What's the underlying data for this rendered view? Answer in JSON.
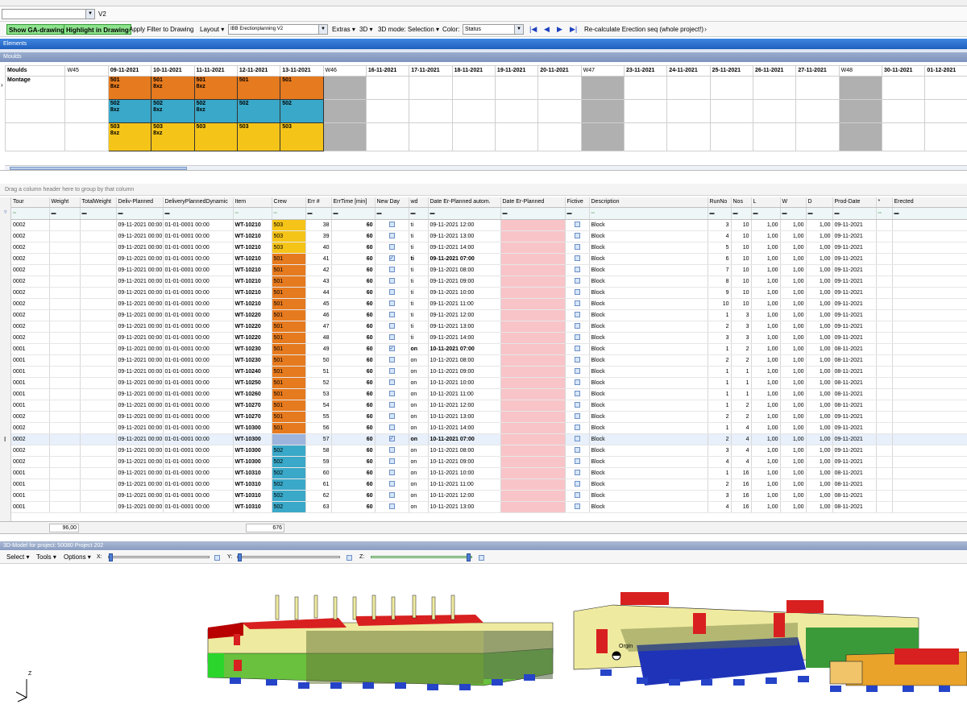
{
  "toolbar1": {
    "version": "V2"
  },
  "toolbar2": {
    "show_ga": "Show GA-drawing",
    "highlight": "Highlight in Drawing",
    "apply_filter": "Apply Filter to Drawing",
    "layout": "Layout",
    "layout_value": "IBB Erectionplanning V2",
    "extras": "Extras",
    "three_d": "3D",
    "mode": "3D mode: Selection",
    "color_label": "Color:",
    "color_value": "Status",
    "recalc": "Re-calculate Erection seq (whole project!)"
  },
  "sections": {
    "elements": "Elements",
    "moulds": "Moulds",
    "model": "3D-Model for project: 50080 Project 202"
  },
  "calendar": {
    "corner": "Moulds",
    "row_label": "Montage",
    "cols": [
      "W45",
      "09-11-2021",
      "10-11-2021",
      "11-11-2021",
      "12-11-2021",
      "13-11-2021",
      "W46",
      "16-11-2021",
      "17-11-2021",
      "18-11-2021",
      "19-11-2021",
      "20-11-2021",
      "W47",
      "23-11-2021",
      "24-11-2021",
      "25-11-2021",
      "26-11-2021",
      "27-11-2021",
      "W48",
      "30-11-2021",
      "01-12-2021"
    ],
    "rows": [
      [
        "501 8xz",
        "501 8xz",
        "501 8xz",
        "501",
        "501"
      ],
      [
        "502 8xz",
        "502 8xz",
        "502 8xz",
        "502",
        "502"
      ],
      [
        "503 8xz",
        "503 8xz",
        "503",
        "503",
        "503"
      ]
    ]
  },
  "group_hint": "Drag a column header here to group by that column",
  "table": {
    "headers": [
      "Tour",
      "Weight",
      "TotalWeight",
      "Deliv-Planned",
      "DeliveryPlannedDynamic",
      "Item",
      "Crew",
      "Err #",
      "ErrTime [min]",
      "New Day",
      "wd",
      "Date Er-Planned autom.",
      "Date Er-Planned",
      "Fictive",
      "Description",
      "RunNo",
      "Nos",
      "L",
      "W",
      "D",
      "Prod-Date",
      "*",
      "Erected"
    ],
    "rows": [
      [
        "0002",
        "09-11-2021 00:00",
        "01-01-0001 00:00",
        "WT-10210",
        "503",
        "38",
        "60",
        "0",
        "ti",
        "09-11-2021 12:00",
        "Block",
        "3",
        "10",
        "1,00",
        "1,00",
        "1,00",
        "09-11-2021"
      ],
      [
        "0002",
        "09-11-2021 00:00",
        "01-01-0001 00:00",
        "WT-10210",
        "503",
        "39",
        "60",
        "0",
        "ti",
        "09-11-2021 13:00",
        "Block",
        "4",
        "10",
        "1,00",
        "1,00",
        "1,00",
        "09-11-2021"
      ],
      [
        "0002",
        "09-11-2021 00:00",
        "01-01-0001 00:00",
        "WT-10210",
        "503",
        "40",
        "60",
        "0",
        "ti",
        "09-11-2021 14:00",
        "Block",
        "5",
        "10",
        "1,00",
        "1,00",
        "1,00",
        "09-11-2021"
      ],
      [
        "0002",
        "09-11-2021 00:00",
        "01-01-0001 00:00",
        "WT-10210",
        "501",
        "41",
        "60",
        "1",
        "ti",
        "09-11-2021 07:00",
        "Block",
        "6",
        "10",
        "1,00",
        "1,00",
        "1,00",
        "09-11-2021"
      ],
      [
        "0002",
        "09-11-2021 00:00",
        "01-01-0001 00:00",
        "WT-10210",
        "501",
        "42",
        "60",
        "0",
        "ti",
        "09-11-2021 08:00",
        "Block",
        "7",
        "10",
        "1,00",
        "1,00",
        "1,00",
        "09-11-2021"
      ],
      [
        "0002",
        "09-11-2021 00:00",
        "01-01-0001 00:00",
        "WT-10210",
        "501",
        "43",
        "60",
        "0",
        "ti",
        "09-11-2021 09:00",
        "Block",
        "8",
        "10",
        "1,00",
        "1,00",
        "1,00",
        "09-11-2021"
      ],
      [
        "0002",
        "09-11-2021 00:00",
        "01-01-0001 00:00",
        "WT-10210",
        "501",
        "44",
        "60",
        "0",
        "ti",
        "09-11-2021 10:00",
        "Block",
        "9",
        "10",
        "1,00",
        "1,00",
        "1,00",
        "09-11-2021"
      ],
      [
        "0002",
        "09-11-2021 00:00",
        "01-01-0001 00:00",
        "WT-10210",
        "501",
        "45",
        "60",
        "0",
        "ti",
        "09-11-2021 11:00",
        "Block",
        "10",
        "10",
        "1,00",
        "1,00",
        "1,00",
        "09-11-2021"
      ],
      [
        "0002",
        "09-11-2021 00:00",
        "01-01-0001 00:00",
        "WT-10220",
        "501",
        "46",
        "60",
        "0",
        "ti",
        "09-11-2021 12:00",
        "Block",
        "1",
        "3",
        "1,00",
        "1,00",
        "1,00",
        "09-11-2021"
      ],
      [
        "0002",
        "09-11-2021 00:00",
        "01-01-0001 00:00",
        "WT-10220",
        "501",
        "47",
        "60",
        "0",
        "ti",
        "09-11-2021 13:00",
        "Block",
        "2",
        "3",
        "1,00",
        "1,00",
        "1,00",
        "09-11-2021"
      ],
      [
        "0002",
        "09-11-2021 00:00",
        "01-01-0001 00:00",
        "WT-10220",
        "501",
        "48",
        "60",
        "0",
        "ti",
        "09-11-2021 14:00",
        "Block",
        "3",
        "3",
        "1,00",
        "1,00",
        "1,00",
        "09-11-2021"
      ],
      [
        "0001",
        "09-11-2021 00:00",
        "01-01-0001 00:00",
        "WT-10230",
        "501",
        "49",
        "60",
        "1",
        "on",
        "10-11-2021 07:00",
        "Block",
        "1",
        "2",
        "1,00",
        "1,00",
        "1,00",
        "08-11-2021"
      ],
      [
        "0001",
        "09-11-2021 00:00",
        "01-01-0001 00:00",
        "WT-10230",
        "501",
        "50",
        "60",
        "0",
        "on",
        "10-11-2021 08:00",
        "Block",
        "2",
        "2",
        "1,00",
        "1,00",
        "1,00",
        "08-11-2021"
      ],
      [
        "0001",
        "09-11-2021 00:00",
        "01-01-0001 00:00",
        "WT-10240",
        "501",
        "51",
        "60",
        "0",
        "on",
        "10-11-2021 09:00",
        "Block",
        "1",
        "1",
        "1,00",
        "1,00",
        "1,00",
        "08-11-2021"
      ],
      [
        "0001",
        "09-11-2021 00:00",
        "01-01-0001 00:00",
        "WT-10250",
        "501",
        "52",
        "60",
        "0",
        "on",
        "10-11-2021 10:00",
        "Block",
        "1",
        "1",
        "1,00",
        "1,00",
        "1,00",
        "08-11-2021"
      ],
      [
        "0001",
        "09-11-2021 00:00",
        "01-01-0001 00:00",
        "WT-10260",
        "501",
        "53",
        "60",
        "0",
        "on",
        "10-11-2021 11:00",
        "Block",
        "1",
        "1",
        "1,00",
        "1,00",
        "1,00",
        "08-11-2021"
      ],
      [
        "0001",
        "09-11-2021 00:00",
        "01-01-0001 00:00",
        "WT-10270",
        "501",
        "54",
        "60",
        "0",
        "on",
        "10-11-2021 12:00",
        "Block",
        "1",
        "2",
        "1,00",
        "1,00",
        "1,00",
        "08-11-2021"
      ],
      [
        "0002",
        "09-11-2021 00:00",
        "01-01-0001 00:00",
        "WT-10270",
        "501",
        "55",
        "60",
        "0",
        "on",
        "10-11-2021 13:00",
        "Block",
        "2",
        "2",
        "1,00",
        "1,00",
        "1,00",
        "09-11-2021"
      ],
      [
        "0002",
        "09-11-2021 00:00",
        "01-01-0001 00:00",
        "WT-10300",
        "501",
        "56",
        "60",
        "0",
        "on",
        "10-11-2021 14:00",
        "Block",
        "1",
        "4",
        "1,00",
        "1,00",
        "1,00",
        "09-11-2021"
      ],
      [
        "0002",
        "09-11-2021 00:00",
        "01-01-0001 00:00",
        "WT-10300",
        "",
        "57",
        "60",
        "1",
        "on",
        "10-11-2021 07:00",
        "Block",
        "2",
        "4",
        "1,00",
        "1,00",
        "1,00",
        "09-11-2021"
      ],
      [
        "0002",
        "09-11-2021 00:00",
        "01-01-0001 00:00",
        "WT-10300",
        "502",
        "58",
        "60",
        "0",
        "on",
        "10-11-2021 08:00",
        "Block",
        "3",
        "4",
        "1,00",
        "1,00",
        "1,00",
        "09-11-2021"
      ],
      [
        "0002",
        "09-11-2021 00:00",
        "01-01-0001 00:00",
        "WT-10300",
        "502",
        "59",
        "60",
        "0",
        "on",
        "10-11-2021 09:00",
        "Block",
        "4",
        "4",
        "1,00",
        "1,00",
        "1,00",
        "09-11-2021"
      ],
      [
        "0001",
        "09-11-2021 00:00",
        "01-01-0001 00:00",
        "WT-10310",
        "502",
        "60",
        "60",
        "0",
        "on",
        "10-11-2021 10:00",
        "Block",
        "1",
        "16",
        "1,00",
        "1,00",
        "1,00",
        "08-11-2021"
      ],
      [
        "0001",
        "09-11-2021 00:00",
        "01-01-0001 00:00",
        "WT-10310",
        "502",
        "61",
        "60",
        "0",
        "on",
        "10-11-2021 11:00",
        "Block",
        "2",
        "16",
        "1,00",
        "1,00",
        "1,00",
        "08-11-2021"
      ],
      [
        "0001",
        "09-11-2021 00:00",
        "01-01-0001 00:00",
        "WT-10310",
        "502",
        "62",
        "60",
        "0",
        "on",
        "10-11-2021 12:00",
        "Block",
        "3",
        "16",
        "1,00",
        "1,00",
        "1,00",
        "08-11-2021"
      ],
      [
        "0001",
        "09-11-2021 00:00",
        "01-01-0001 00:00",
        "WT-10310",
        "502",
        "63",
        "60",
        "0",
        "on",
        "10-11-2021 13:00",
        "Block",
        "4",
        "16",
        "1,00",
        "1,00",
        "1,00",
        "08-11-2021"
      ]
    ],
    "weight_total": "96,00",
    "item_count": "676"
  },
  "model_toolbar": {
    "select": "Select",
    "tools": "Tools",
    "options": "Options",
    "x": "X:",
    "y": "Y:",
    "z": "Z:"
  },
  "model": {
    "origin": "Orgin",
    "axis_z": "Z"
  },
  "colors": {
    "orange": "#e67a1e",
    "blue": "#3aa8c8",
    "yellow": "#f5c418",
    "pink": "#f8c4c8",
    "green": "#8ee38e"
  }
}
